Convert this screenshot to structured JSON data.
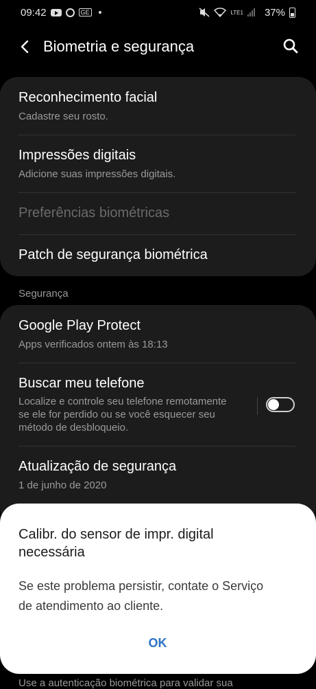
{
  "status_bar": {
    "time": "09:42",
    "battery": "37%",
    "network": "LTE1"
  },
  "header": {
    "title": "Biometria e segurança"
  },
  "biometrics": [
    {
      "title": "Reconhecimento facial",
      "subtitle": "Cadastre seu rosto."
    },
    {
      "title": "Impressões digitais",
      "subtitle": "Adicione suas impressões digitais."
    },
    {
      "title": "Preferências biométricas",
      "subtitle": ""
    },
    {
      "title": "Patch de segurança biométrica",
      "subtitle": ""
    }
  ],
  "security_section": {
    "label": "Segurança",
    "items": [
      {
        "title": "Google Play Protect",
        "subtitle": "Apps verificados ontem às 18:13"
      },
      {
        "title": "Buscar meu telefone",
        "subtitle_lines": [
          "Localize e controle seu telefone remotamente",
          "se ele for perdido ou se você esquecer seu",
          "método de desbloqueio."
        ],
        "toggle_on": false
      },
      {
        "title": "Atualização de segurança",
        "subtitle": "1 de junho de 2020"
      }
    ]
  },
  "dialog": {
    "title_lines": [
      "Calibr. do sensor de impr. digital",
      "necessária"
    ],
    "body_lines": [
      "Se este problema persistir, contate o Serviço",
      "de atendimento ao cliente."
    ],
    "ok": "OK"
  },
  "bottom_text": "Use a autenticação biométrica para validar sua",
  "colors": {
    "accent": "#2d73c4",
    "card": "#1c1c1c",
    "background": "#000000"
  }
}
